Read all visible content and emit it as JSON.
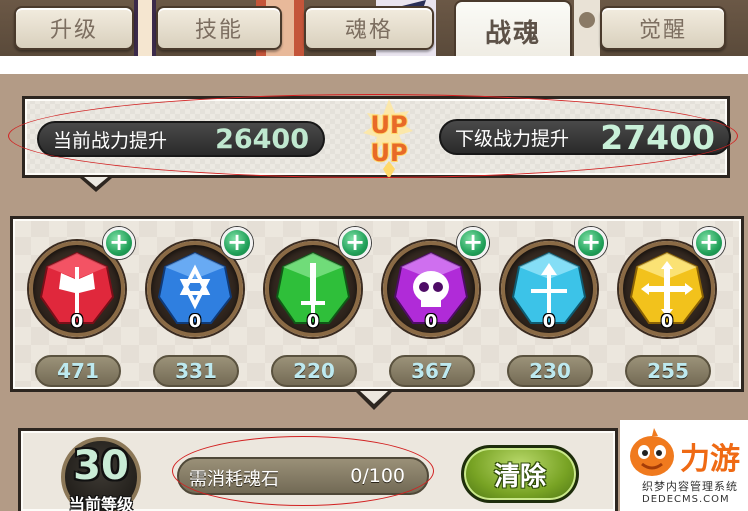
{
  "tabs": [
    {
      "label": "升级",
      "active": false
    },
    {
      "label": "技能",
      "active": false
    },
    {
      "label": "魂格",
      "active": false
    },
    {
      "label": "战魂",
      "active": true
    },
    {
      "label": "觉醒",
      "active": false
    }
  ],
  "power": {
    "current_label": "当前战力提升",
    "current_value": "26400",
    "next_label": "下级战力提升",
    "next_value": "27400",
    "up_badge": "UP UP"
  },
  "gems": [
    {
      "icon": "red-axe-gem-icon",
      "color": "#e0283c",
      "count": "0",
      "stat": "471"
    },
    {
      "icon": "blue-star-gem-icon",
      "color": "#2f7fe0",
      "count": "0",
      "stat": "331"
    },
    {
      "icon": "green-sword-gem-icon",
      "color": "#2fbf3a",
      "count": "0",
      "stat": "220"
    },
    {
      "icon": "purple-skull-gem-icon",
      "color": "#b02bd8",
      "count": "0",
      "stat": "367"
    },
    {
      "icon": "cyan-arrow-gem-icon",
      "color": "#3cc3e8",
      "count": "0",
      "stat": "230"
    },
    {
      "icon": "yellow-cross-gem-icon",
      "color": "#f2c21c",
      "count": "0",
      "stat": "255"
    }
  ],
  "level": {
    "value": "30",
    "label": "当前等级"
  },
  "cost": {
    "label": "需消耗魂石",
    "value": "0/100"
  },
  "clear_button": "清除",
  "watermark": {
    "brand": "力游",
    "line1": "织梦内容管理系统",
    "line2": "DEDECMS.COM"
  }
}
